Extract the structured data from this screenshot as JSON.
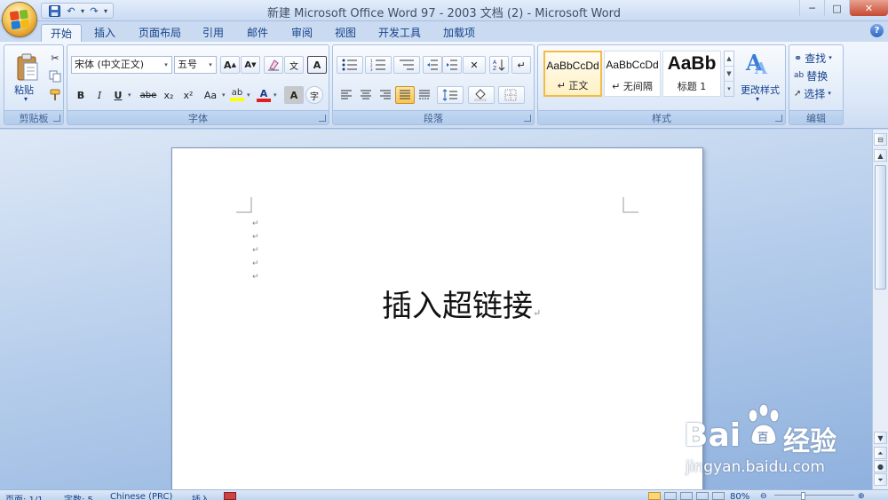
{
  "window": {
    "title": "新建 Microsoft Office Word 97 - 2003 文档 (2) - Microsoft Word",
    "controls": {
      "minimize": "─",
      "maximize": "□",
      "close": "✕"
    }
  },
  "qat": {
    "save_icon": "floppy-icon",
    "undo_icon": "undo-icon",
    "redo_icon": "redo-icon"
  },
  "tabs": [
    {
      "label": "开始",
      "active": true
    },
    {
      "label": "插入"
    },
    {
      "label": "页面布局"
    },
    {
      "label": "引用"
    },
    {
      "label": "邮件"
    },
    {
      "label": "审阅"
    },
    {
      "label": "视图"
    },
    {
      "label": "开发工具"
    },
    {
      "label": "加载项"
    }
  ],
  "ribbon": {
    "clipboard": {
      "label": "剪贴板",
      "paste": "粘贴"
    },
    "font": {
      "label": "字体",
      "font_name": "宋体 (中文正文)",
      "font_size": "五号",
      "bold": "B",
      "italic": "I",
      "underline": "U",
      "strike": "abe",
      "subscript": "x₂",
      "superscript": "x²",
      "change_case": "Aa",
      "grow": "A",
      "shrink": "A",
      "highlight": "ab",
      "font_color": "A",
      "char_shading": "A",
      "phonetic": "文",
      "enclose": "字",
      "border_char": "A"
    },
    "paragraph": {
      "label": "段落"
    },
    "styles": {
      "label": "样式",
      "cards": [
        {
          "sample": "AaBbCcDd",
          "name": "↵ 正文",
          "selected": true
        },
        {
          "sample": "AaBbCcDd",
          "name": "↵ 无间隔"
        },
        {
          "sample": "AaBb",
          "name": "标题 1"
        }
      ],
      "change_styles": "更改样式"
    },
    "editing": {
      "label": "编辑",
      "find": "查找",
      "replace": "替换",
      "select": "选择"
    }
  },
  "document": {
    "text": "插入超链接",
    "enter_mark": "↵",
    "empty_marks": [
      "↵",
      "↵",
      "↵",
      "↵",
      "↵"
    ]
  },
  "statusbar": {
    "page": "页面: 1/1",
    "words": "字数: 5",
    "language": "Chinese (PRC)",
    "insert": "插入",
    "zoom": "80%"
  },
  "watermark": {
    "brand": "Bai",
    "brand2": "百",
    "suffix": "经验",
    "url": "jingyan.baidu.com"
  },
  "colors": {
    "accent": "#15428b",
    "highlight": "#ffff00",
    "font_color": "#e02020",
    "selected_style_border": "#f1bc46"
  }
}
